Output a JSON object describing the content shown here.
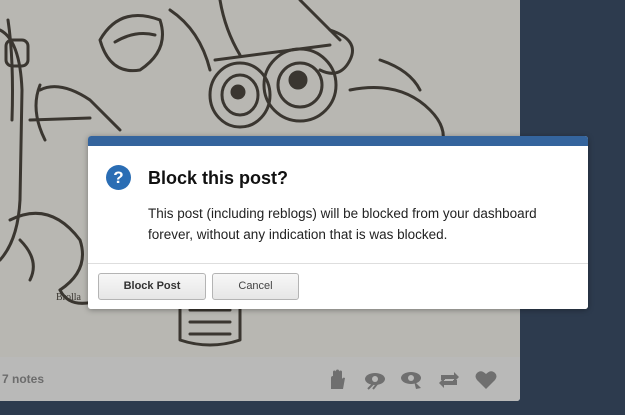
{
  "post": {
    "notes": "7 notes",
    "actions": [
      {
        "icon": "hand-icon"
      },
      {
        "icon": "hide-icon"
      },
      {
        "icon": "view-icon"
      },
      {
        "icon": "reblog-icon"
      },
      {
        "icon": "heart-icon"
      }
    ]
  },
  "dialog": {
    "icon": "?",
    "title": "Block this post?",
    "message": "This post (including reblogs) will be blocked from your dashboard forever, without any indication that is was blocked.",
    "confirm_label": "Block Post",
    "cancel_label": "Cancel"
  },
  "colors": {
    "page_background": "#2d3b4e",
    "dialog_bar": "#34649d",
    "dialog_icon": "#2a6db4"
  }
}
